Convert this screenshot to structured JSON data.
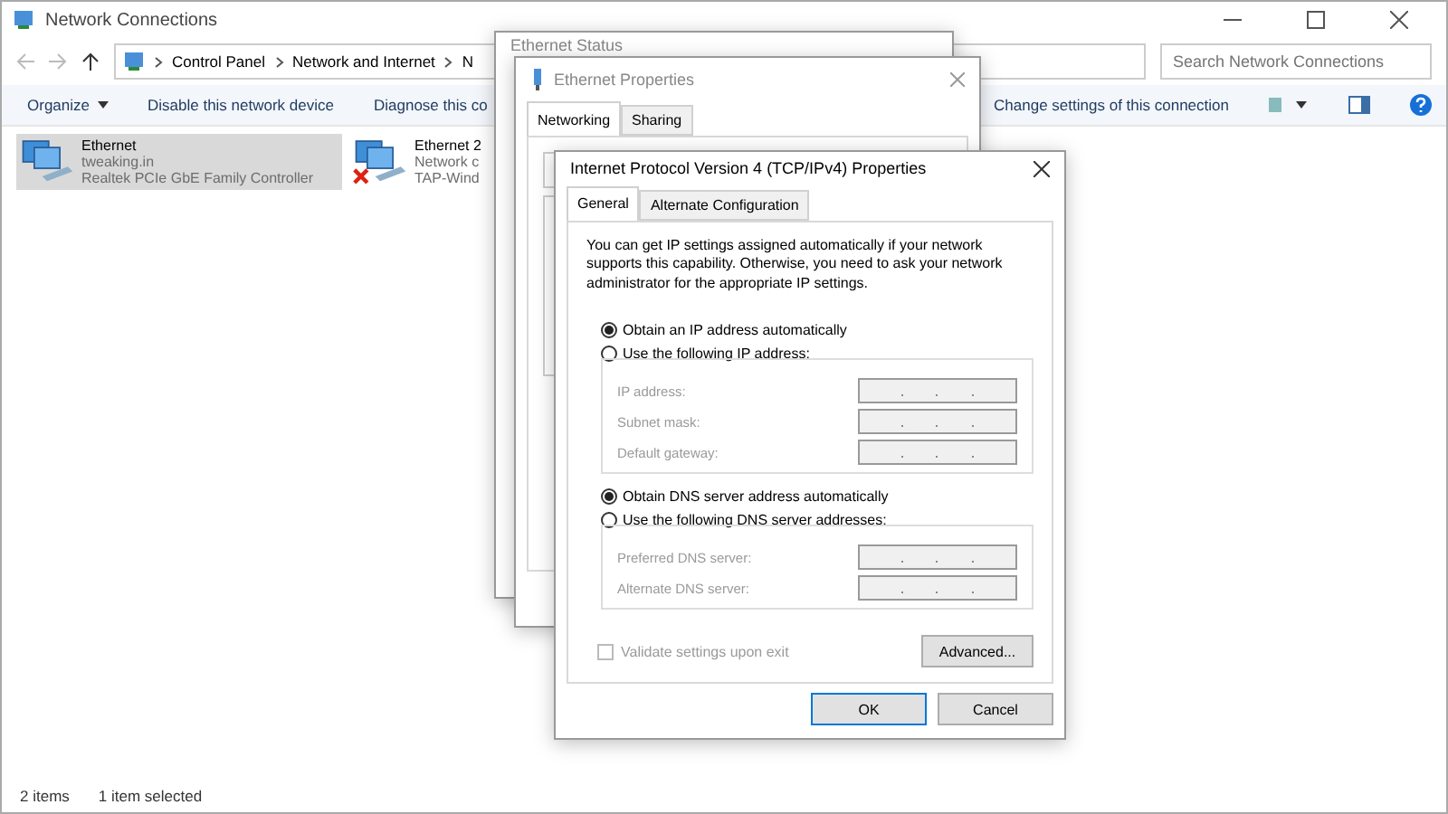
{
  "explorer": {
    "title": "Network Connections",
    "breadcrumb": [
      "Control Panel",
      "Network and Internet",
      "N"
    ],
    "search": {
      "placeholder": "Search Network Connections"
    },
    "toolbar": [
      {
        "label": "Organize",
        "kind": "menu"
      },
      {
        "label": "Disable this network device",
        "kind": "plain"
      },
      {
        "label": "Diagnose this co",
        "kind": "plain"
      }
    ],
    "toolbar_right": [
      "Change settings of this connection"
    ],
    "connections": [
      {
        "name": "Ethernet",
        "network": "tweaking.in",
        "adapter": "Realtek PCIe GbE Family Controller",
        "selected": true,
        "disconnected": false
      },
      {
        "name": "Ethernet 2",
        "network": "Network c",
        "adapter": "TAP-Wind",
        "selected": false,
        "disconnected": true
      }
    ],
    "status_bar": [
      "2 items",
      "1 item selected"
    ]
  },
  "status_window": {
    "title": "Ethernet Status"
  },
  "properties_window": {
    "title": "Ethernet Properties",
    "tabs": [
      {
        "label": "Networking",
        "selected": true
      },
      {
        "label": "Sharing",
        "selected": false
      }
    ]
  },
  "ipv4_dialog": {
    "title": "Internet Protocol Version 4 (TCP/IPv4) Properties",
    "tabs": [
      {
        "label": "General",
        "selected": true
      },
      {
        "label": "Alternate Configuration",
        "selected": false
      }
    ],
    "intro": "You can get IP settings assigned automatically if your network supports this capability. Otherwise, you need to ask your network administrator for the appropriate IP settings.",
    "ip_options": [
      {
        "label": "Obtain an IP address automatically",
        "selected": true
      },
      {
        "label": "Use the following IP address:",
        "selected": false
      }
    ],
    "ip_fields": [
      {
        "label": "IP address:",
        "disabled": true
      },
      {
        "label": "Subnet mask:",
        "disabled": true
      },
      {
        "label": "Default gateway:",
        "disabled": true
      }
    ],
    "dns_options": [
      {
        "label": "Obtain DNS server address automatically",
        "selected": true
      },
      {
        "label": "Use the following DNS server addresses:",
        "selected": false
      }
    ],
    "dns_fields": [
      {
        "label": "Preferred DNS server:",
        "disabled": true
      },
      {
        "label": "Alternate DNS server:",
        "disabled": true
      }
    ],
    "validate": {
      "label": "Validate settings upon exit",
      "checked": false,
      "disabled": true
    },
    "advanced": "Advanced...",
    "buttons": [
      {
        "label": "OK",
        "default": true
      },
      {
        "label": "Cancel",
        "default": false
      }
    ]
  }
}
